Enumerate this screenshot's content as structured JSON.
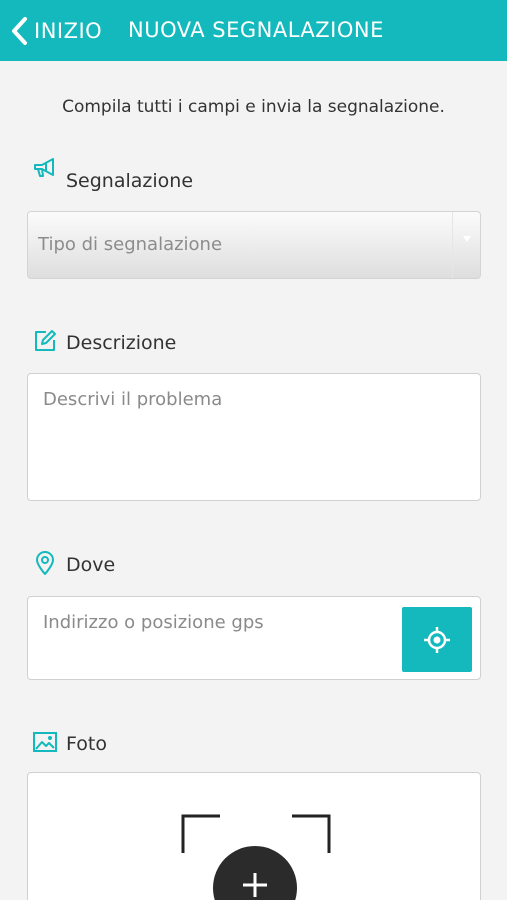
{
  "header": {
    "back_label": "INIZIO",
    "title": "NUOVA SEGNALAZIONE"
  },
  "intro": "Compila tutti i campi e invia la segnalazione.",
  "segnalazione": {
    "label": "Segnalazione",
    "placeholder": "Tipo di segnalazione",
    "icon": "megaphone-icon"
  },
  "descrizione": {
    "label": "Descrizione",
    "placeholder": "Descrivi il problema",
    "icon": "edit-icon"
  },
  "dove": {
    "label": "Dove",
    "placeholder": "Indirizzo o posizione gps",
    "icon": "location-pin-icon",
    "gps_icon": "gps-target-icon"
  },
  "foto": {
    "label": "Foto",
    "icon": "image-icon",
    "add_icon": "plus-icon"
  },
  "colors": {
    "accent": "#13b9bc",
    "background": "#f3f3f3",
    "add_button": "#2b2b2b"
  }
}
